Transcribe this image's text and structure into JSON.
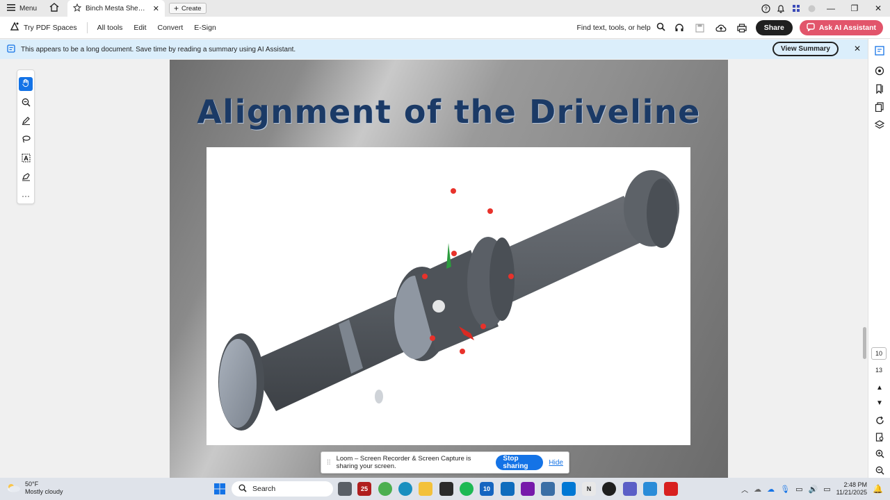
{
  "titlebar": {
    "menu_label": "Menu",
    "tab_title": "Binch Mesta Shear Pres...",
    "create_label": "Create"
  },
  "toolbar": {
    "try_spaces": "Try PDF Spaces",
    "all_tools": "All tools",
    "edit": "Edit",
    "convert": "Convert",
    "esign": "E-Sign",
    "find_text": "Find text, tools, or help",
    "share": "Share",
    "ask_ai": "Ask AI Assistant"
  },
  "banner": {
    "message": "This appears to be a long document. Save time by reading a summary using AI Assistant.",
    "view_summary": "View Summary"
  },
  "document": {
    "slide_title": "Alignment of the Driveline"
  },
  "pagination": {
    "current_page": "10",
    "total_pages": "13"
  },
  "loom": {
    "message": "Loom – Screen Recorder & Screen Capture is sharing your screen.",
    "stop_sharing": "Stop sharing",
    "hide": "Hide"
  },
  "taskbar": {
    "temperature": "50°F",
    "weather": "Mostly cloudy",
    "search_placeholder": "Search",
    "time": "2:48 PM",
    "date": "11/21/2025"
  },
  "colors": {
    "accent_blue": "#1473e6",
    "ai_pink": "#e2556b",
    "banner_bg": "#dbeefb",
    "slide_title": "#1b3a66"
  }
}
